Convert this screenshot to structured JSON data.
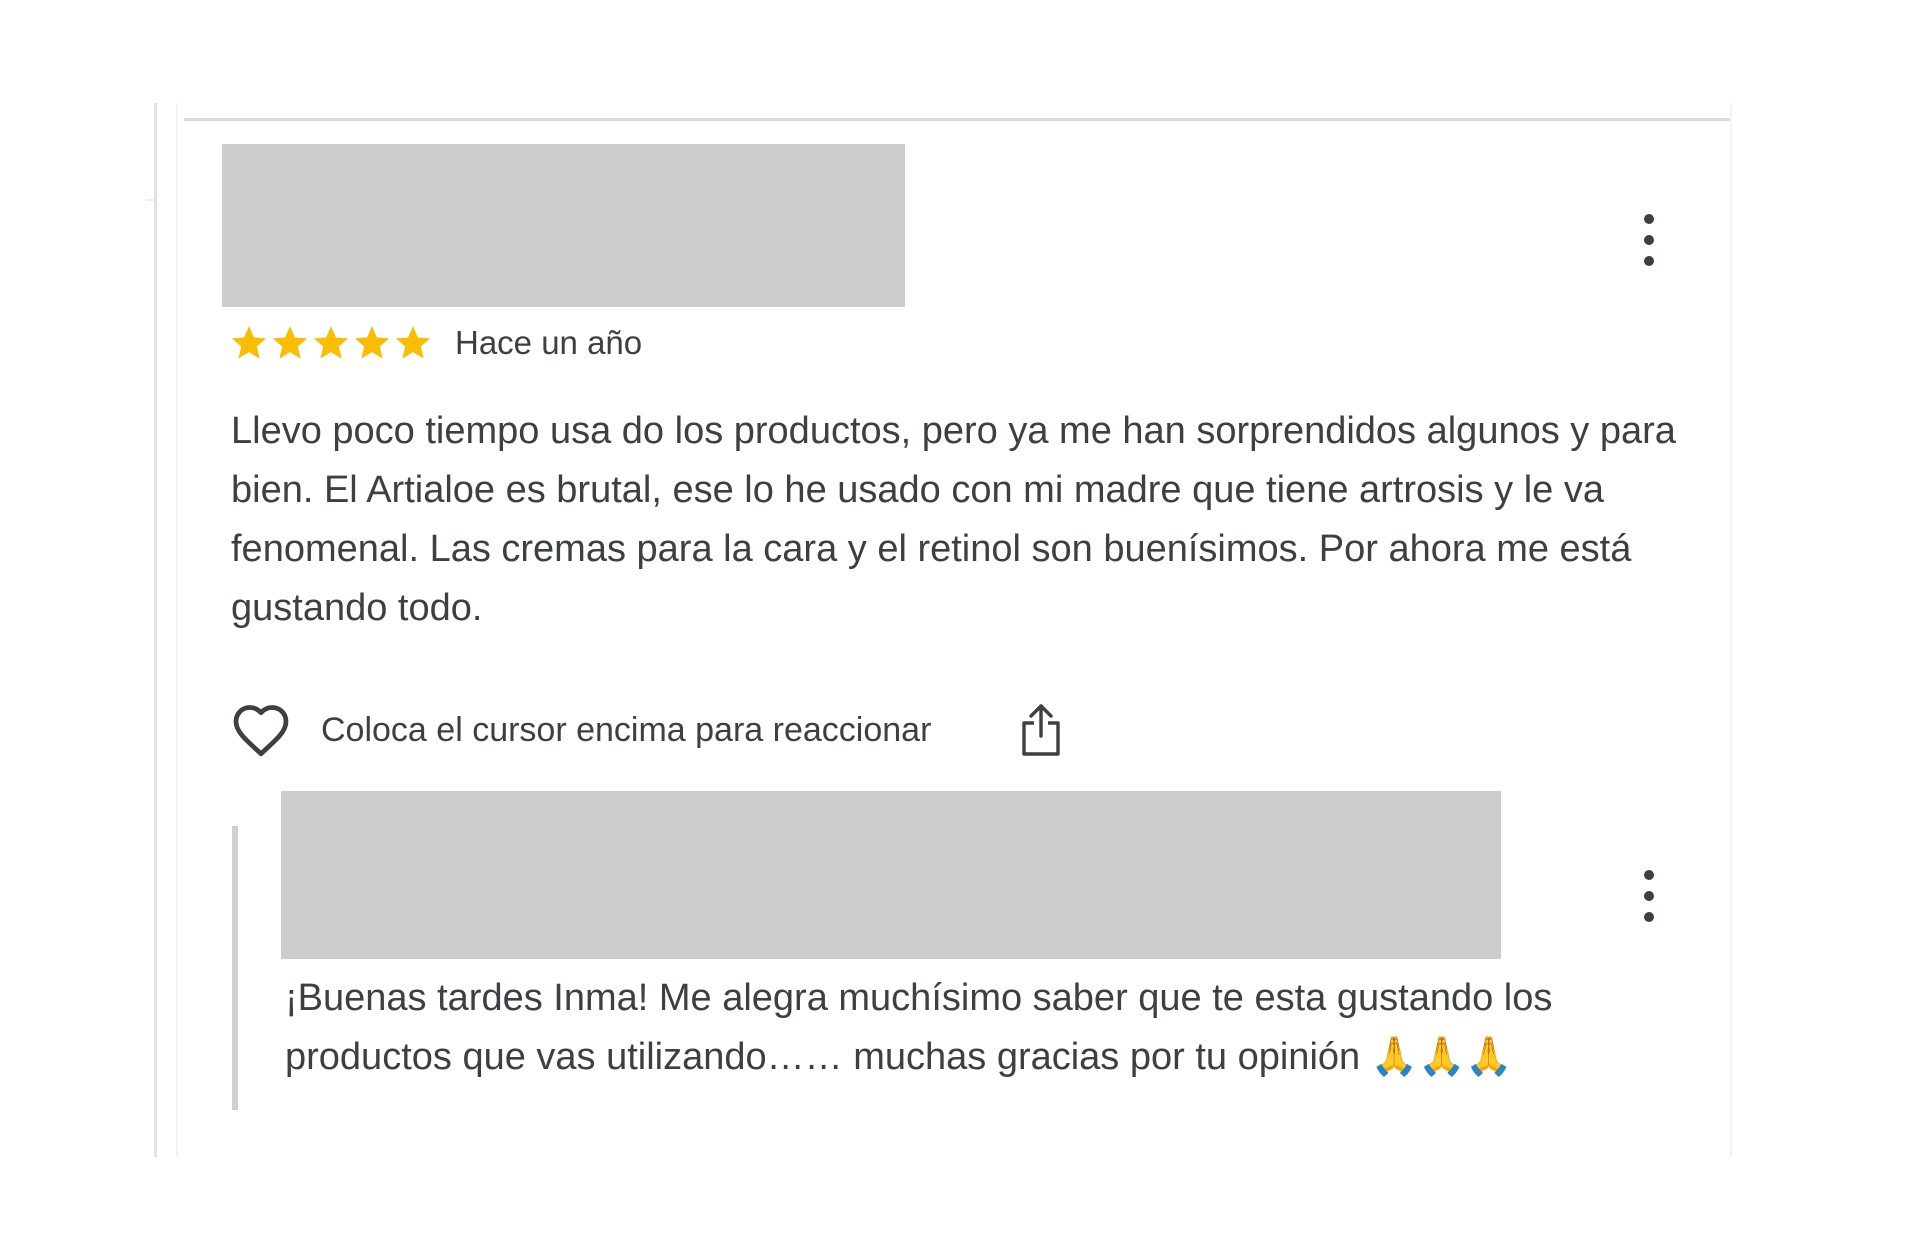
{
  "review": {
    "rating": 5,
    "rating_max": 5,
    "star_color": "#fbbc04",
    "date": "Hace un año",
    "text": "Llevo poco tiempo usa do los productos, pero ya me han sorprendidos algunos y para bien. El Artialoe es brutal, ese lo he usado con mi madre que tiene artrosis y le va fenomenal. Las cremas para la cara y el retinol son buenísimos. Por ahora me está gustando todo.",
    "menu_icon": "more-vert-icon"
  },
  "actions": {
    "react_label": "Coloca el cursor encima para reaccionar",
    "heart_icon": "heart-outline-icon",
    "share_icon": "share-icon"
  },
  "reply": {
    "text": "¡Buenas tardes Inma! Me alegra muchísimo saber que te esta gustando los productos que vas utilizando…… muchas gracias por tu opinión 🙏🙏🙏",
    "menu_icon": "more-vert-icon"
  },
  "colors": {
    "text": "#3c4043",
    "redacted": "#cccccc",
    "divider": "#dadce0"
  }
}
